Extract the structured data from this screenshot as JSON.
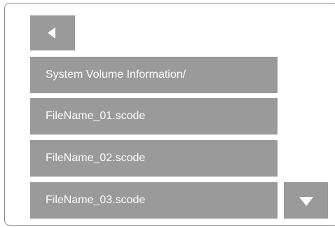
{
  "navigation": {
    "back_icon": "triangle-left-icon",
    "scroll_down_icon": "triangle-down-icon"
  },
  "file_list": {
    "items": [
      {
        "label": "System Volume Information/"
      },
      {
        "label": "FileName_01.scode"
      },
      {
        "label": "FileName_02.scode"
      },
      {
        "label": "FileName_03.scode"
      }
    ]
  },
  "colors": {
    "button_background": "#9a9a9a",
    "button_text": "#ffffff",
    "panel_border": "#8a8a8a"
  }
}
